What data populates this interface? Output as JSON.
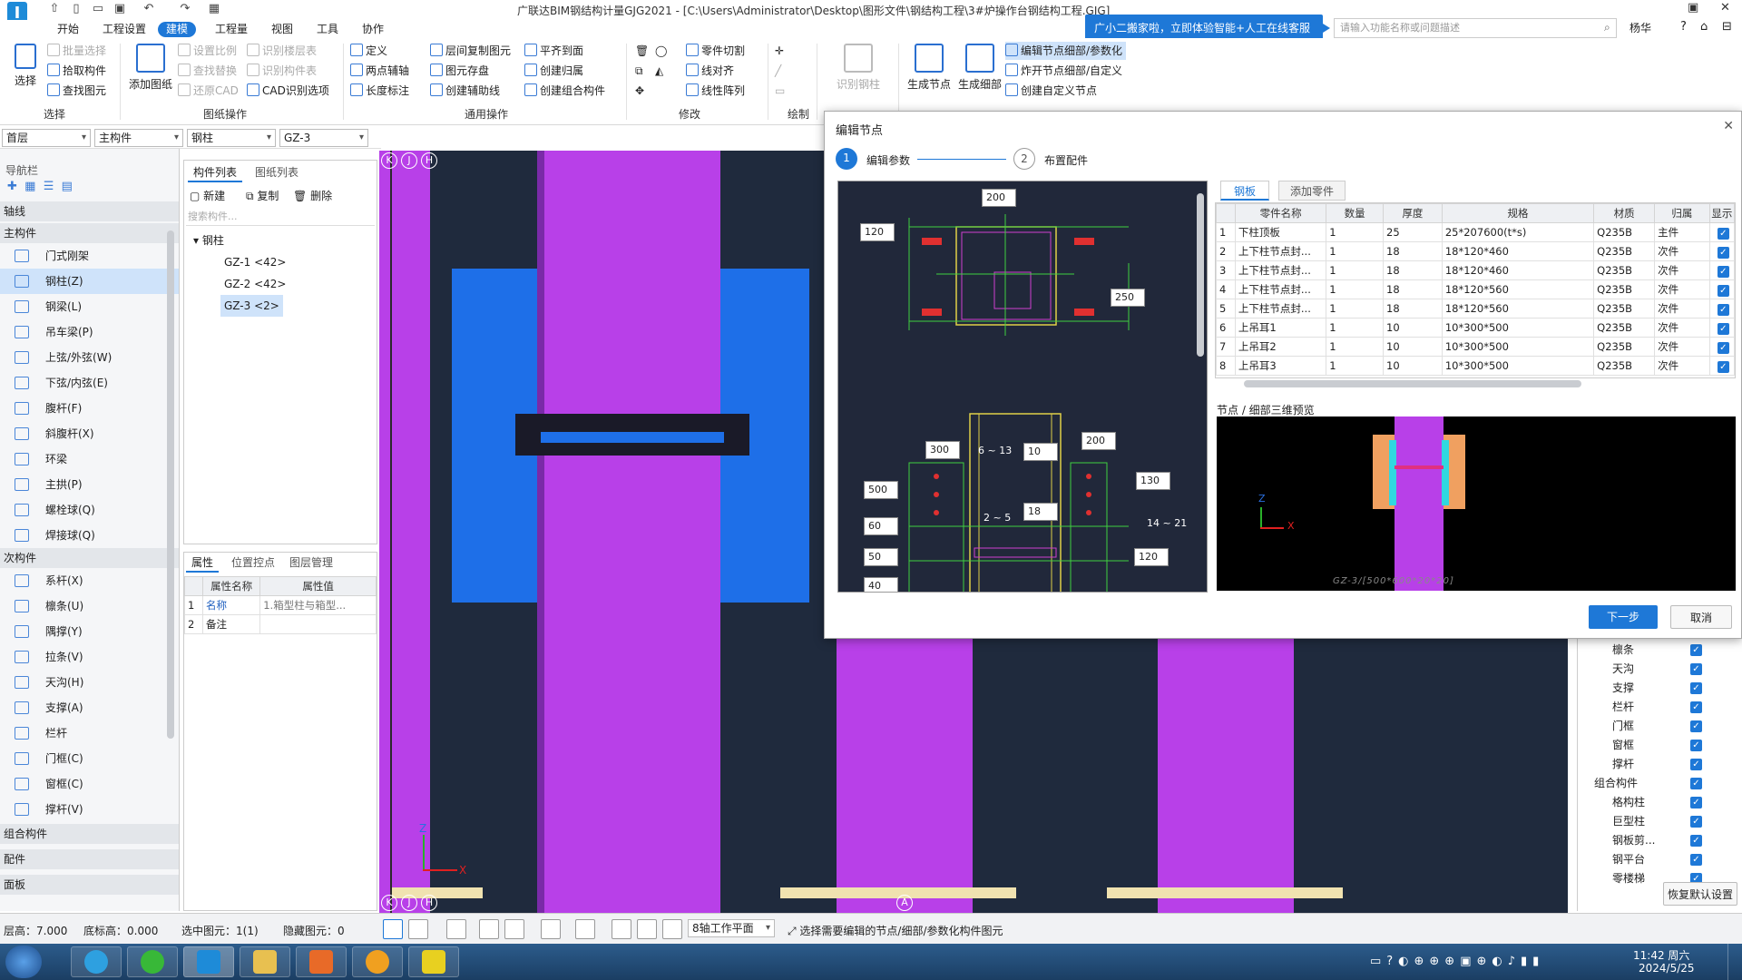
{
  "app": {
    "title": "广联达BIM钢结构计量GJG2021 - [C:\\Users\\Administrator\\Desktop\\图形文件\\钢结构工程\\3#炉操作台钢结构工程.GJG]",
    "user": "杨华"
  },
  "menu": {
    "tabs": [
      "开始",
      "工程设置",
      "建模",
      "工程量",
      "视图",
      "工具",
      "协作"
    ],
    "active": "建模"
  },
  "promo": "广小二搬家啦，立即体验智能+人工在线客服",
  "help_search": {
    "placeholder": "请输入功能名称或问题描述"
  },
  "ribbon": {
    "select": {
      "big": "选择",
      "items": [
        "批量选择",
        "拾取构件",
        "查找图元"
      ],
      "group": "选择"
    },
    "drawing": {
      "big": "添加图纸",
      "items": [
        "设置比例",
        "查找替换",
        "还原CAD",
        "识别楼层表",
        "识别构件表",
        "CAD识别选项"
      ],
      "group": "图纸操作"
    },
    "common": {
      "items": [
        "定义",
        "两点辅轴",
        "长度标注",
        "层间复制图元",
        "图元存盘",
        "创建辅助线",
        "平齐到面",
        "创建归属",
        "创建组合构件"
      ],
      "group": "通用操作"
    },
    "modify": {
      "items": [
        "零件切割",
        "线对齐",
        "线性阵列"
      ],
      "group": "修改"
    },
    "draw": {
      "group": "绘制"
    },
    "steel": {
      "big": "识别钢柱"
    },
    "node": {
      "big1": "生成节点",
      "big2": "生成细部",
      "items": [
        "编辑节点细部/参数化",
        "炸开节点细部/自定义",
        "创建自定义节点"
      ]
    }
  },
  "selectors": [
    "首层",
    "主构件",
    "钢柱",
    "GZ-3"
  ],
  "nav": {
    "title": "导航栏",
    "cat_axis": "轴线",
    "cat_main": "主构件",
    "main_items": [
      "门式刚架",
      "钢柱(Z)",
      "钢梁(L)",
      "吊车梁(P)",
      "上弦/外弦(W)",
      "下弦/内弦(E)",
      "腹杆(F)",
      "斜腹杆(X)",
      "环梁",
      "主拱(P)",
      "螺栓球(Q)",
      "焊接球(Q)"
    ],
    "cat_sub": "次构件",
    "sub_items": [
      "系杆(X)",
      "檩条(U)",
      "隅撑(Y)",
      "拉条(V)",
      "天沟(H)",
      "支撑(A)",
      "栏杆",
      "门框(C)",
      "窗框(C)",
      "撑杆(V)"
    ],
    "cat_combo": "组合构件",
    "cat_fitting": "配件",
    "cat_plate": "面板"
  },
  "complist": {
    "tabs": [
      "构件列表",
      "图纸列表"
    ],
    "actions": [
      "新建",
      "复制",
      "删除"
    ],
    "search_placeholder": "搜索构件...",
    "group": "钢柱",
    "items": [
      "GZ-1 <42>",
      "GZ-2 <42>",
      "GZ-3 <2>"
    ]
  },
  "props": {
    "tabs": [
      "属性",
      "位置控点",
      "图层管理"
    ],
    "headers": [
      "属性名称",
      "属性值"
    ],
    "rows": [
      [
        "1",
        "名称",
        "1.箱型柱与箱型..."
      ],
      [
        "2",
        "备注",
        ""
      ]
    ]
  },
  "canvas": {
    "axis_top": [
      "K",
      "J",
      "H"
    ],
    "axis_bottom": [
      "K",
      "J",
      "H",
      "A"
    ],
    "axis_x": "X",
    "axis_z": "Z"
  },
  "dialog": {
    "title": "编辑节点",
    "steps": [
      {
        "num": "1",
        "label": "编辑参数"
      },
      {
        "num": "2",
        "label": "布置配件"
      }
    ],
    "tabs": [
      "钢板",
      "添加零件"
    ],
    "headers": [
      "",
      "零件名称",
      "数量",
      "厚度",
      "规格",
      "材质",
      "归属",
      "显示"
    ],
    "rows": [
      [
        "1",
        "下柱顶板",
        "1",
        "25",
        "25*207600(t*s)",
        "Q235B",
        "主件"
      ],
      [
        "2",
        "上下柱节点封...",
        "1",
        "18",
        "18*120*460",
        "Q235B",
        "次件"
      ],
      [
        "3",
        "上下柱节点封...",
        "1",
        "18",
        "18*120*460",
        "Q235B",
        "次件"
      ],
      [
        "4",
        "上下柱节点封...",
        "1",
        "18",
        "18*120*560",
        "Q235B",
        "次件"
      ],
      [
        "5",
        "上下柱节点封...",
        "1",
        "18",
        "18*120*560",
        "Q235B",
        "次件"
      ],
      [
        "6",
        "上吊耳1",
        "1",
        "10",
        "10*300*500",
        "Q235B",
        "次件"
      ],
      [
        "7",
        "上吊耳2",
        "1",
        "10",
        "10*300*500",
        "Q235B",
        "次件"
      ],
      [
        "8",
        "上吊耳3",
        "1",
        "10",
        "10*300*500",
        "Q235B",
        "次件"
      ]
    ],
    "preview_label": "节点 / 细部三维预览",
    "preview_caption": "GZ-3/[500*600*20*20]",
    "dims": [
      "200",
      "120",
      "250",
      "300",
      "10",
      "200",
      "500",
      "130",
      "18",
      "60",
      "50",
      "120",
      "40"
    ],
    "circles": [
      "6 ~ 13",
      "2 ~ 5",
      "14 ~ 21"
    ],
    "next": "下一步",
    "cancel": "取消"
  },
  "layers": {
    "items": [
      "檩条",
      "天沟",
      "支撑",
      "栏杆",
      "门框",
      "窗框",
      "撑杆",
      "组合构件",
      "格构柱",
      "巨型柱",
      "钢板剪...",
      "钢平台",
      "零楼梯"
    ],
    "restore": "恢复默认设置"
  },
  "status": {
    "floor_height": "层高：7.000",
    "base_elev": "底标高：0.000",
    "selected": "选中图元：1(1)",
    "hidden": "隐藏图元：0",
    "plane": "8轴工作平面",
    "hint": "选择需要编辑的节点/细部/参数化构件图元"
  },
  "taskbar": {
    "time": "11:42 周六",
    "date": "2024/5/25"
  },
  "colors": {
    "accent": "#1e78d7",
    "canvas_bg": "#1f2a3d",
    "column": "#b840e8",
    "plate": "#1e6fe8"
  }
}
